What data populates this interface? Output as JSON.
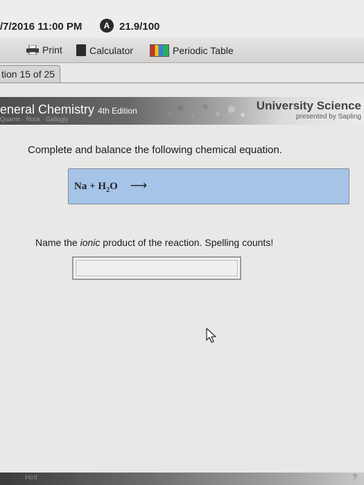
{
  "topbar": {
    "datetime": "/7/2016 11:00 PM",
    "score_badge": "A",
    "score": "21.9/100"
  },
  "toolbar": {
    "print": "Print",
    "calculator": "Calculator",
    "periodic_table": "Periodic Table"
  },
  "question_tab": "tion 15 of 25",
  "banner": {
    "title": "eneral Chemistry",
    "edition": "4th Edition",
    "authors": "Quarris · Rock · Gallogly",
    "publisher": "University Science",
    "publisher_sub": "presented by Sapling"
  },
  "question": {
    "prompt": "Complete and balance the following chemical equation.",
    "equation": {
      "reactants": "Na + H",
      "subscript": "2",
      "tail": "O",
      "arrow": "⟶"
    },
    "prompt2_pre": "Name the ",
    "prompt2_em": "ionic",
    "prompt2_post": " product of the reaction. Spelling counts!",
    "answer_value": ""
  },
  "footer": {
    "hint": "Hint",
    "help": "?"
  }
}
